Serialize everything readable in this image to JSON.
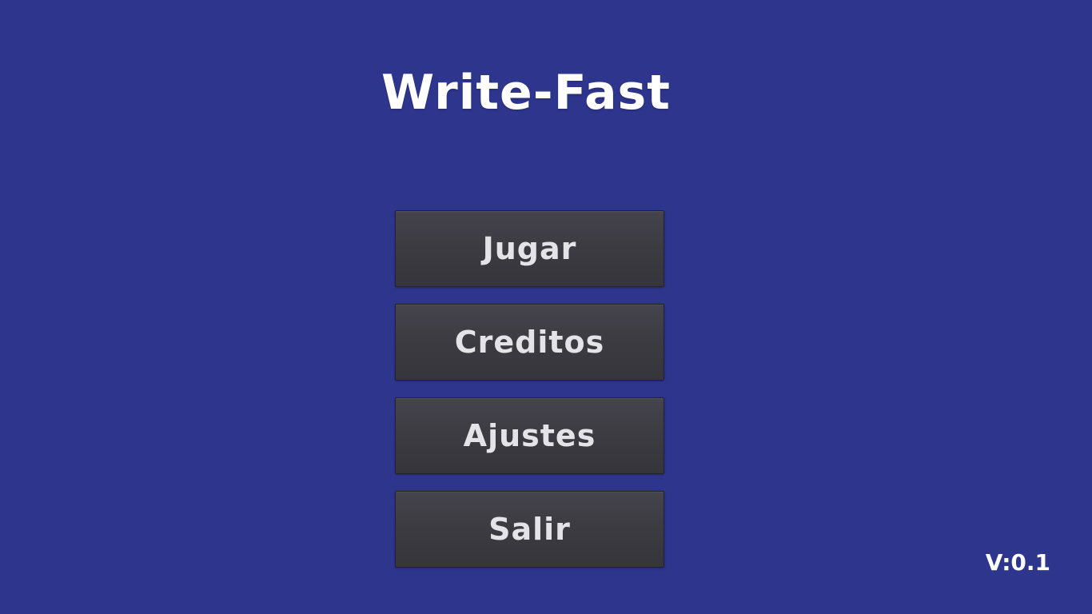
{
  "game": {
    "title": "Write-Fast",
    "background_color": "#2e358c"
  },
  "menu": {
    "items": [
      {
        "id": "jugar",
        "label": "Jugar"
      },
      {
        "id": "creditos",
        "label": "Creditos"
      },
      {
        "id": "ajustes",
        "label": "Ajustes"
      },
      {
        "id": "salir",
        "label": "Salir"
      }
    ]
  },
  "footer": {
    "version": "V:0.1"
  }
}
